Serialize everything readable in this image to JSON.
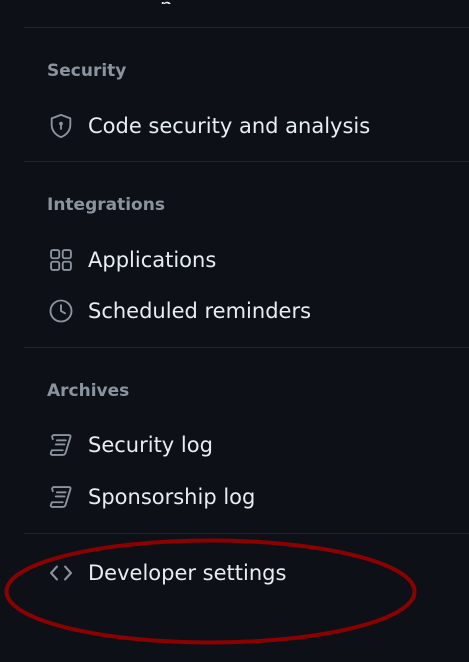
{
  "sections": [
    {
      "title": "Security",
      "items": [
        {
          "label": "Code security and analysis",
          "icon": "shield-lock-icon"
        }
      ]
    },
    {
      "title": "Integrations",
      "items": [
        {
          "label": "Applications",
          "icon": "apps-grid-icon"
        },
        {
          "label": "Scheduled reminders",
          "icon": "clock-icon"
        }
      ]
    },
    {
      "title": "Archives",
      "items": [
        {
          "label": "Security log",
          "icon": "log-icon"
        },
        {
          "label": "Sponsorship log",
          "icon": "log-icon"
        }
      ]
    }
  ],
  "developer": {
    "label": "Developer settings",
    "icon": "code-icon"
  },
  "colors": {
    "background": "#0d1117",
    "text": "#e6edf3",
    "muted": "#8b949e",
    "divider": "#21262d",
    "annotation": "#8b0000"
  }
}
